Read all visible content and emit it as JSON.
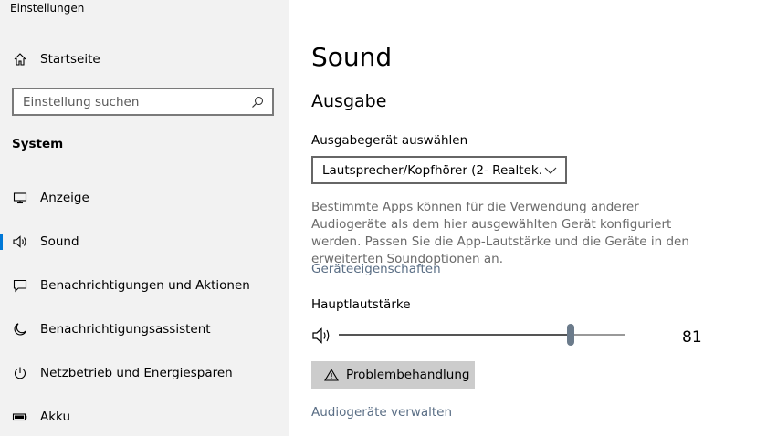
{
  "window": {
    "title": "Einstellungen"
  },
  "sidebar": {
    "home_label": "Startseite",
    "search_placeholder": "Einstellung suchen",
    "section": "System",
    "items": [
      {
        "label": "Anzeige",
        "icon": "monitor-icon"
      },
      {
        "label": "Sound",
        "icon": "speaker-icon",
        "active": true
      },
      {
        "label": "Benachrichtigungen und Aktionen",
        "icon": "notification-icon"
      },
      {
        "label": "Benachrichtigungsassistent",
        "icon": "moon-icon"
      },
      {
        "label": "Netzbetrieb und Energiesparen",
        "icon": "power-icon"
      },
      {
        "label": "Akku",
        "icon": "battery-icon"
      }
    ]
  },
  "main": {
    "title": "Sound",
    "output": {
      "heading": "Ausgabe",
      "device_label": "Ausgabegerät auswählen",
      "device_value": "Lautsprecher/Kopfhörer (2- Realtek...",
      "description": "Bestimmte Apps können für die Verwendung anderer Audiogeräte als dem hier ausgewählten Gerät konfiguriert werden. Passen Sie die App-Lautstärke und die Geräte in den erweiterten Soundoptionen an.",
      "properties_link": "Geräteeigenschaften",
      "volume_label": "Hauptlautstärke",
      "volume_value": "81",
      "volume_level": 81,
      "troubleshoot_label": "Problembehandlung",
      "manage_link": "Audiogeräte verwalten"
    }
  },
  "colors": {
    "sidebar_bg": "#f2f2f2",
    "accent": "#0078d7",
    "link": "#5a6e85",
    "button_bg": "#cccccc"
  }
}
